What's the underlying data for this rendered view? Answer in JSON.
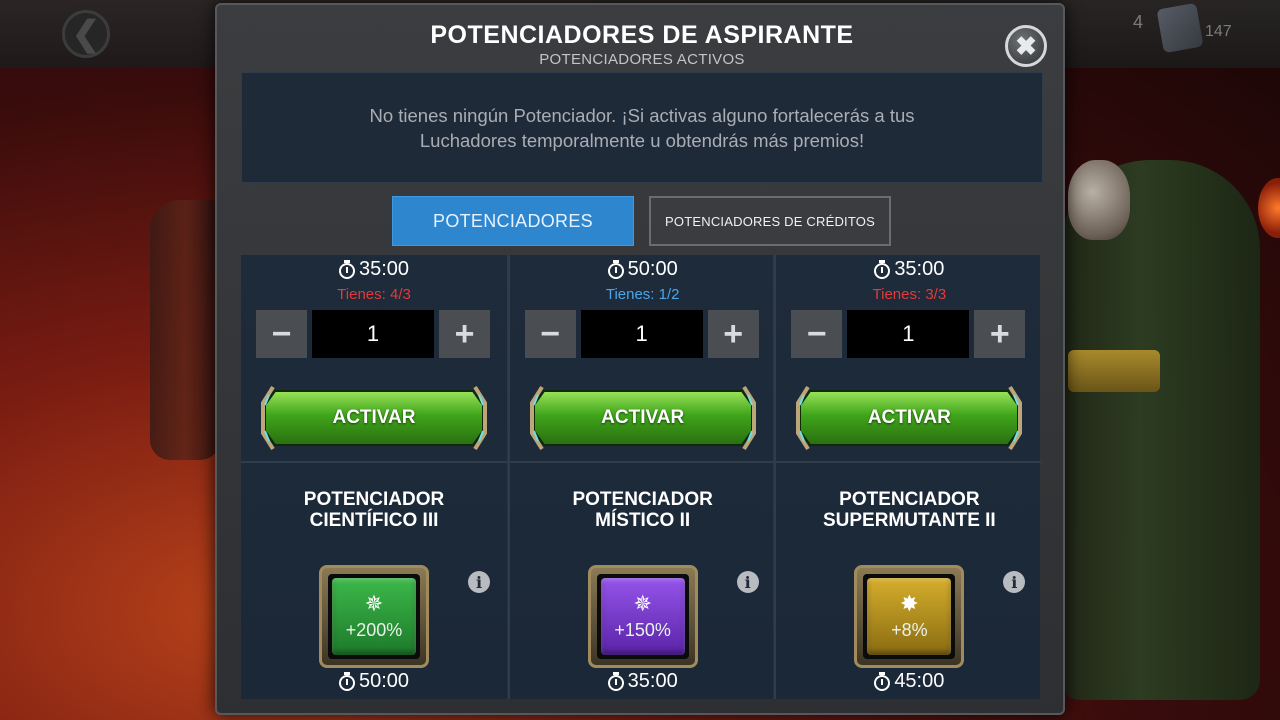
{
  "hud": {
    "back_glyph": "❮",
    "count": "4",
    "resource_amount": "147"
  },
  "modal": {
    "title": "POTENCIADORES DE ASPIRANTE",
    "subtitle": "POTENCIADORES ACTIVOS",
    "close_glyph": "✖",
    "active_message": "No tienes ningún Potenciador. ¡Si activas alguno fortalecerás a tus Luchadores temporalmente u obtendrás más premios!",
    "tabs": [
      {
        "label": "POTENCIADORES",
        "selected": true
      },
      {
        "label": "POTENCIADORES DE CRÉDITOS",
        "selected": false
      }
    ]
  },
  "colors": {
    "tab_selected": "#2e86cf",
    "owned_over": "#e23a3a",
    "owned_ok": "#4aa6e8",
    "scientific": "#2f9a3c",
    "mystic": "#7b3fd4",
    "mutant": "#c6a021",
    "activate_green": "#3fa51a"
  },
  "cards": [
    {
      "duration": "35:00",
      "owned": "Tienes: 4/3",
      "owned_status": "over",
      "quantity": "1",
      "minus": "−",
      "plus": "+",
      "activate_label": "ACTIVAR",
      "name_line1": "POTENCIADOR",
      "name_line2": "CIENTÍFICO III",
      "icon": "scientific-burst-icon",
      "glyph": "✵",
      "bonus": "+200%",
      "remaining": "50:00",
      "info": "i"
    },
    {
      "duration": "50:00",
      "owned": "Tienes: 1/2",
      "owned_status": "ok",
      "quantity": "1",
      "minus": "−",
      "plus": "+",
      "activate_label": "ACTIVAR",
      "name_line1": "POTENCIADOR",
      "name_line2": "MÍSTICO II",
      "icon": "mystic-burst-icon",
      "glyph": "✵",
      "bonus": "+150%",
      "remaining": "35:00",
      "info": "i"
    },
    {
      "duration": "35:00",
      "owned": "Tienes: 3/3",
      "owned_status": "over",
      "quantity": "1",
      "minus": "−",
      "plus": "+",
      "activate_label": "ACTIVAR",
      "name_line1": "POTENCIADOR",
      "name_line2": "SUPERMUTANTE II",
      "icon": "mutant-burst-icon",
      "glyph": "✸",
      "bonus": "+8%",
      "remaining": "45:00",
      "info": "i"
    }
  ]
}
